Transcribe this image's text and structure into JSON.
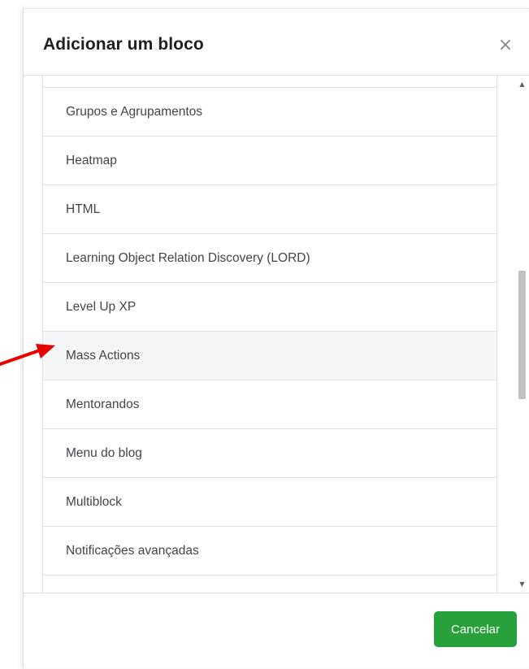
{
  "dialog": {
    "title": "Adicionar um bloco",
    "close_glyph": "×"
  },
  "blocks": [
    {
      "label": "Grupos e Agrupamentos"
    },
    {
      "label": "Heatmap"
    },
    {
      "label": "HTML"
    },
    {
      "label": "Learning Object Relation Discovery (LORD)"
    },
    {
      "label": "Level Up XP"
    },
    {
      "label": "Mass Actions",
      "highlighted": true
    },
    {
      "label": "Mentorandos"
    },
    {
      "label": "Menu do blog"
    },
    {
      "label": "Multiblock"
    },
    {
      "label": "Notificações avançadas"
    }
  ],
  "footer": {
    "cancel_label": "Cancelar"
  },
  "colors": {
    "cancel_button": "#28a03c",
    "annotation_arrow": "#e60000",
    "highlight_row": "#f5f6f8"
  },
  "icons": {
    "close": "close-icon",
    "scroll_up": "scroll-up-arrow-icon",
    "scroll_down": "scroll-down-arrow-icon",
    "annotation": "red-arrow-icon"
  }
}
